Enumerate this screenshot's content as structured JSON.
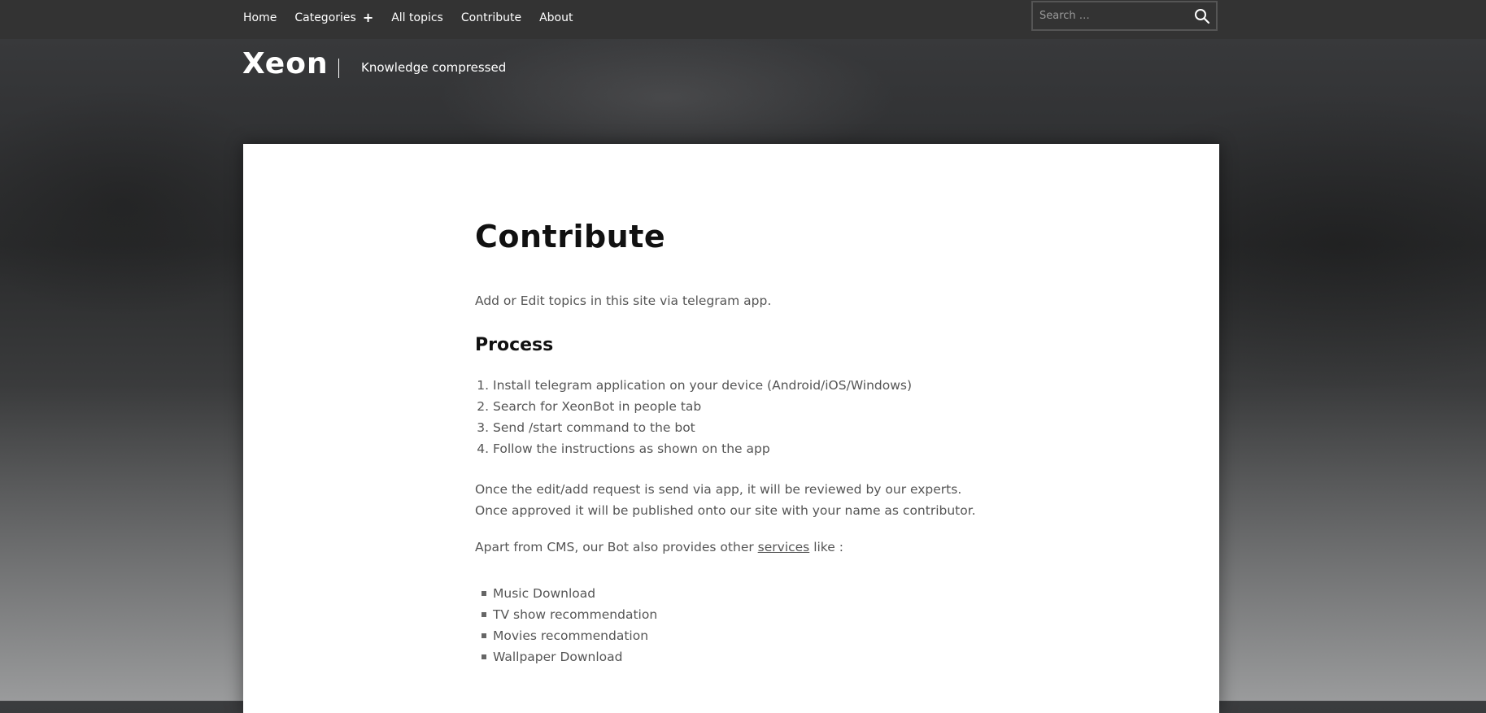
{
  "nav": {
    "items": [
      {
        "label": "Home"
      },
      {
        "label": "Categories"
      },
      {
        "label": "All topics"
      },
      {
        "label": "Contribute"
      },
      {
        "label": "About"
      }
    ],
    "categories_expand_icon": "plus-icon"
  },
  "search": {
    "placeholder": "Search …",
    "icon": "search-icon"
  },
  "site": {
    "title": "Xeon",
    "tagline": "Knowledge compressed"
  },
  "article": {
    "title": "Contribute",
    "intro": "Add or Edit topics in this site via telegram app.",
    "process_heading": "Process",
    "steps": [
      "Install telegram application on your device (Android/iOS/Windows)",
      "Search for XeonBot in people tab",
      "Send /start command to the bot",
      "Follow the instructions as shown on the app"
    ],
    "review_text": "Once the edit/add request is send via app, it will be reviewed by our experts. Once approved it will be published onto our site with your name as contributor.",
    "apart_prefix": "Apart from CMS, our Bot also provides other ",
    "services_link": "services",
    "apart_suffix": " like :",
    "services": [
      "Music Download",
      "TV show recommendation",
      "Movies recommendation",
      "Wallpaper Download"
    ]
  },
  "colors": {
    "topbar": "#333333",
    "card": "#ffffff",
    "heading": "#111111",
    "body_text": "#555555"
  }
}
